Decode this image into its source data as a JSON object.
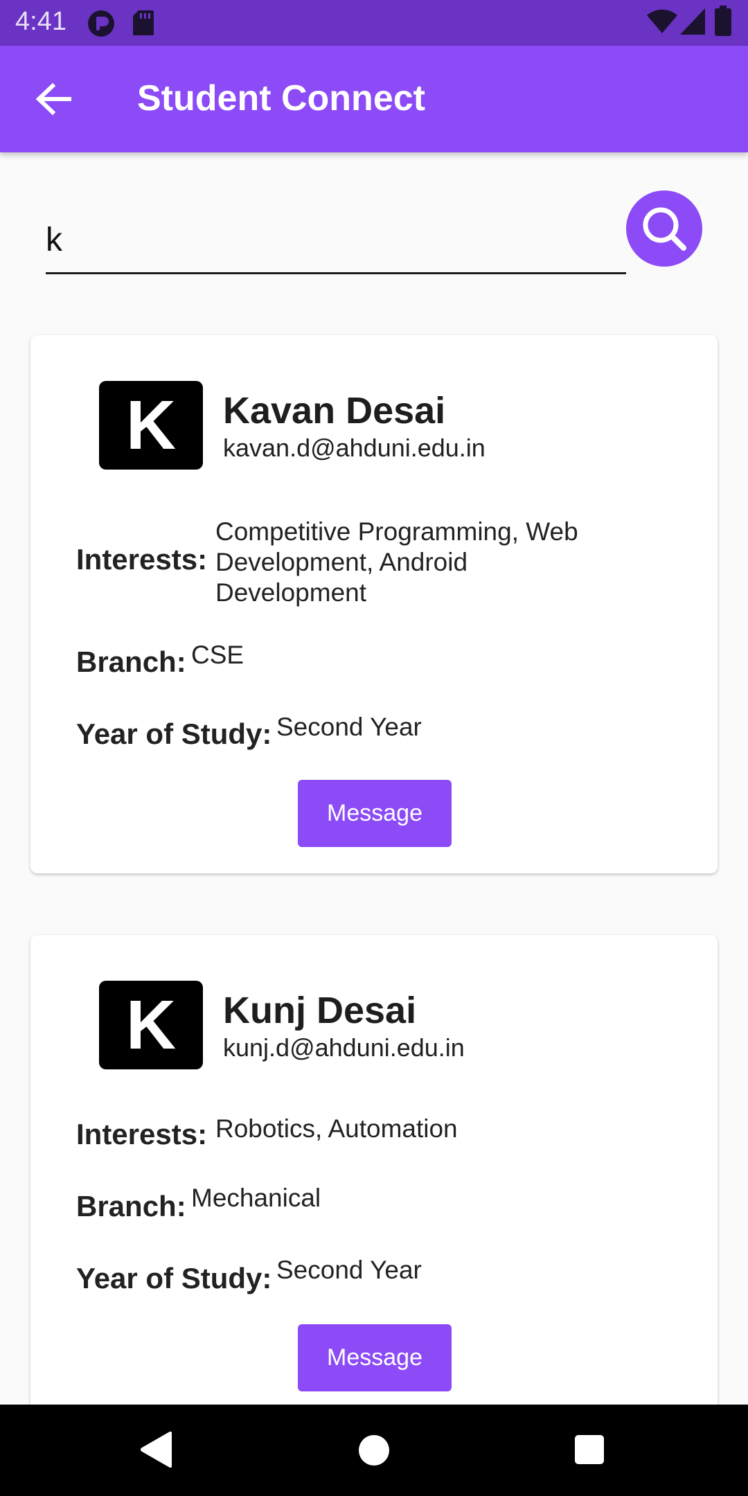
{
  "status_bar": {
    "time": "4:41",
    "left_icons": [
      "notification-app-icon",
      "sd-card-icon"
    ],
    "right_icons": [
      "wifi-icon",
      "signal-icon",
      "battery-icon"
    ]
  },
  "app_bar": {
    "title": "Student Connect",
    "back_icon": "arrow-back-icon",
    "color": "#8c4bf6"
  },
  "search": {
    "value": "k",
    "button_icon": "search-icon"
  },
  "students": [
    {
      "initial": "K",
      "name": "Kavan Desai",
      "email": "kavan.d@ahduni.edu.in",
      "interests_label": "Interests:",
      "interests_lines": [
        "Competitive Programming, Web",
        "Development, Android",
        "Development"
      ],
      "branch_label": "Branch:",
      "branch": "CSE",
      "year_label": "Year of Study:",
      "year": "Second Year",
      "button_label": "Message"
    },
    {
      "initial": "K",
      "name": "Kunj Desai",
      "email": "kunj.d@ahduni.edu.in",
      "interests_label": "Interests:",
      "interests": "Robotics, Automation",
      "branch_label": "Branch:",
      "branch": "Mechanical",
      "year_label": "Year of Study:",
      "year": "Second Year",
      "button_label": "Message"
    }
  ],
  "nav_bar": {
    "icons": [
      "back-triangle-icon",
      "home-circle-icon",
      "recents-square-icon"
    ]
  }
}
